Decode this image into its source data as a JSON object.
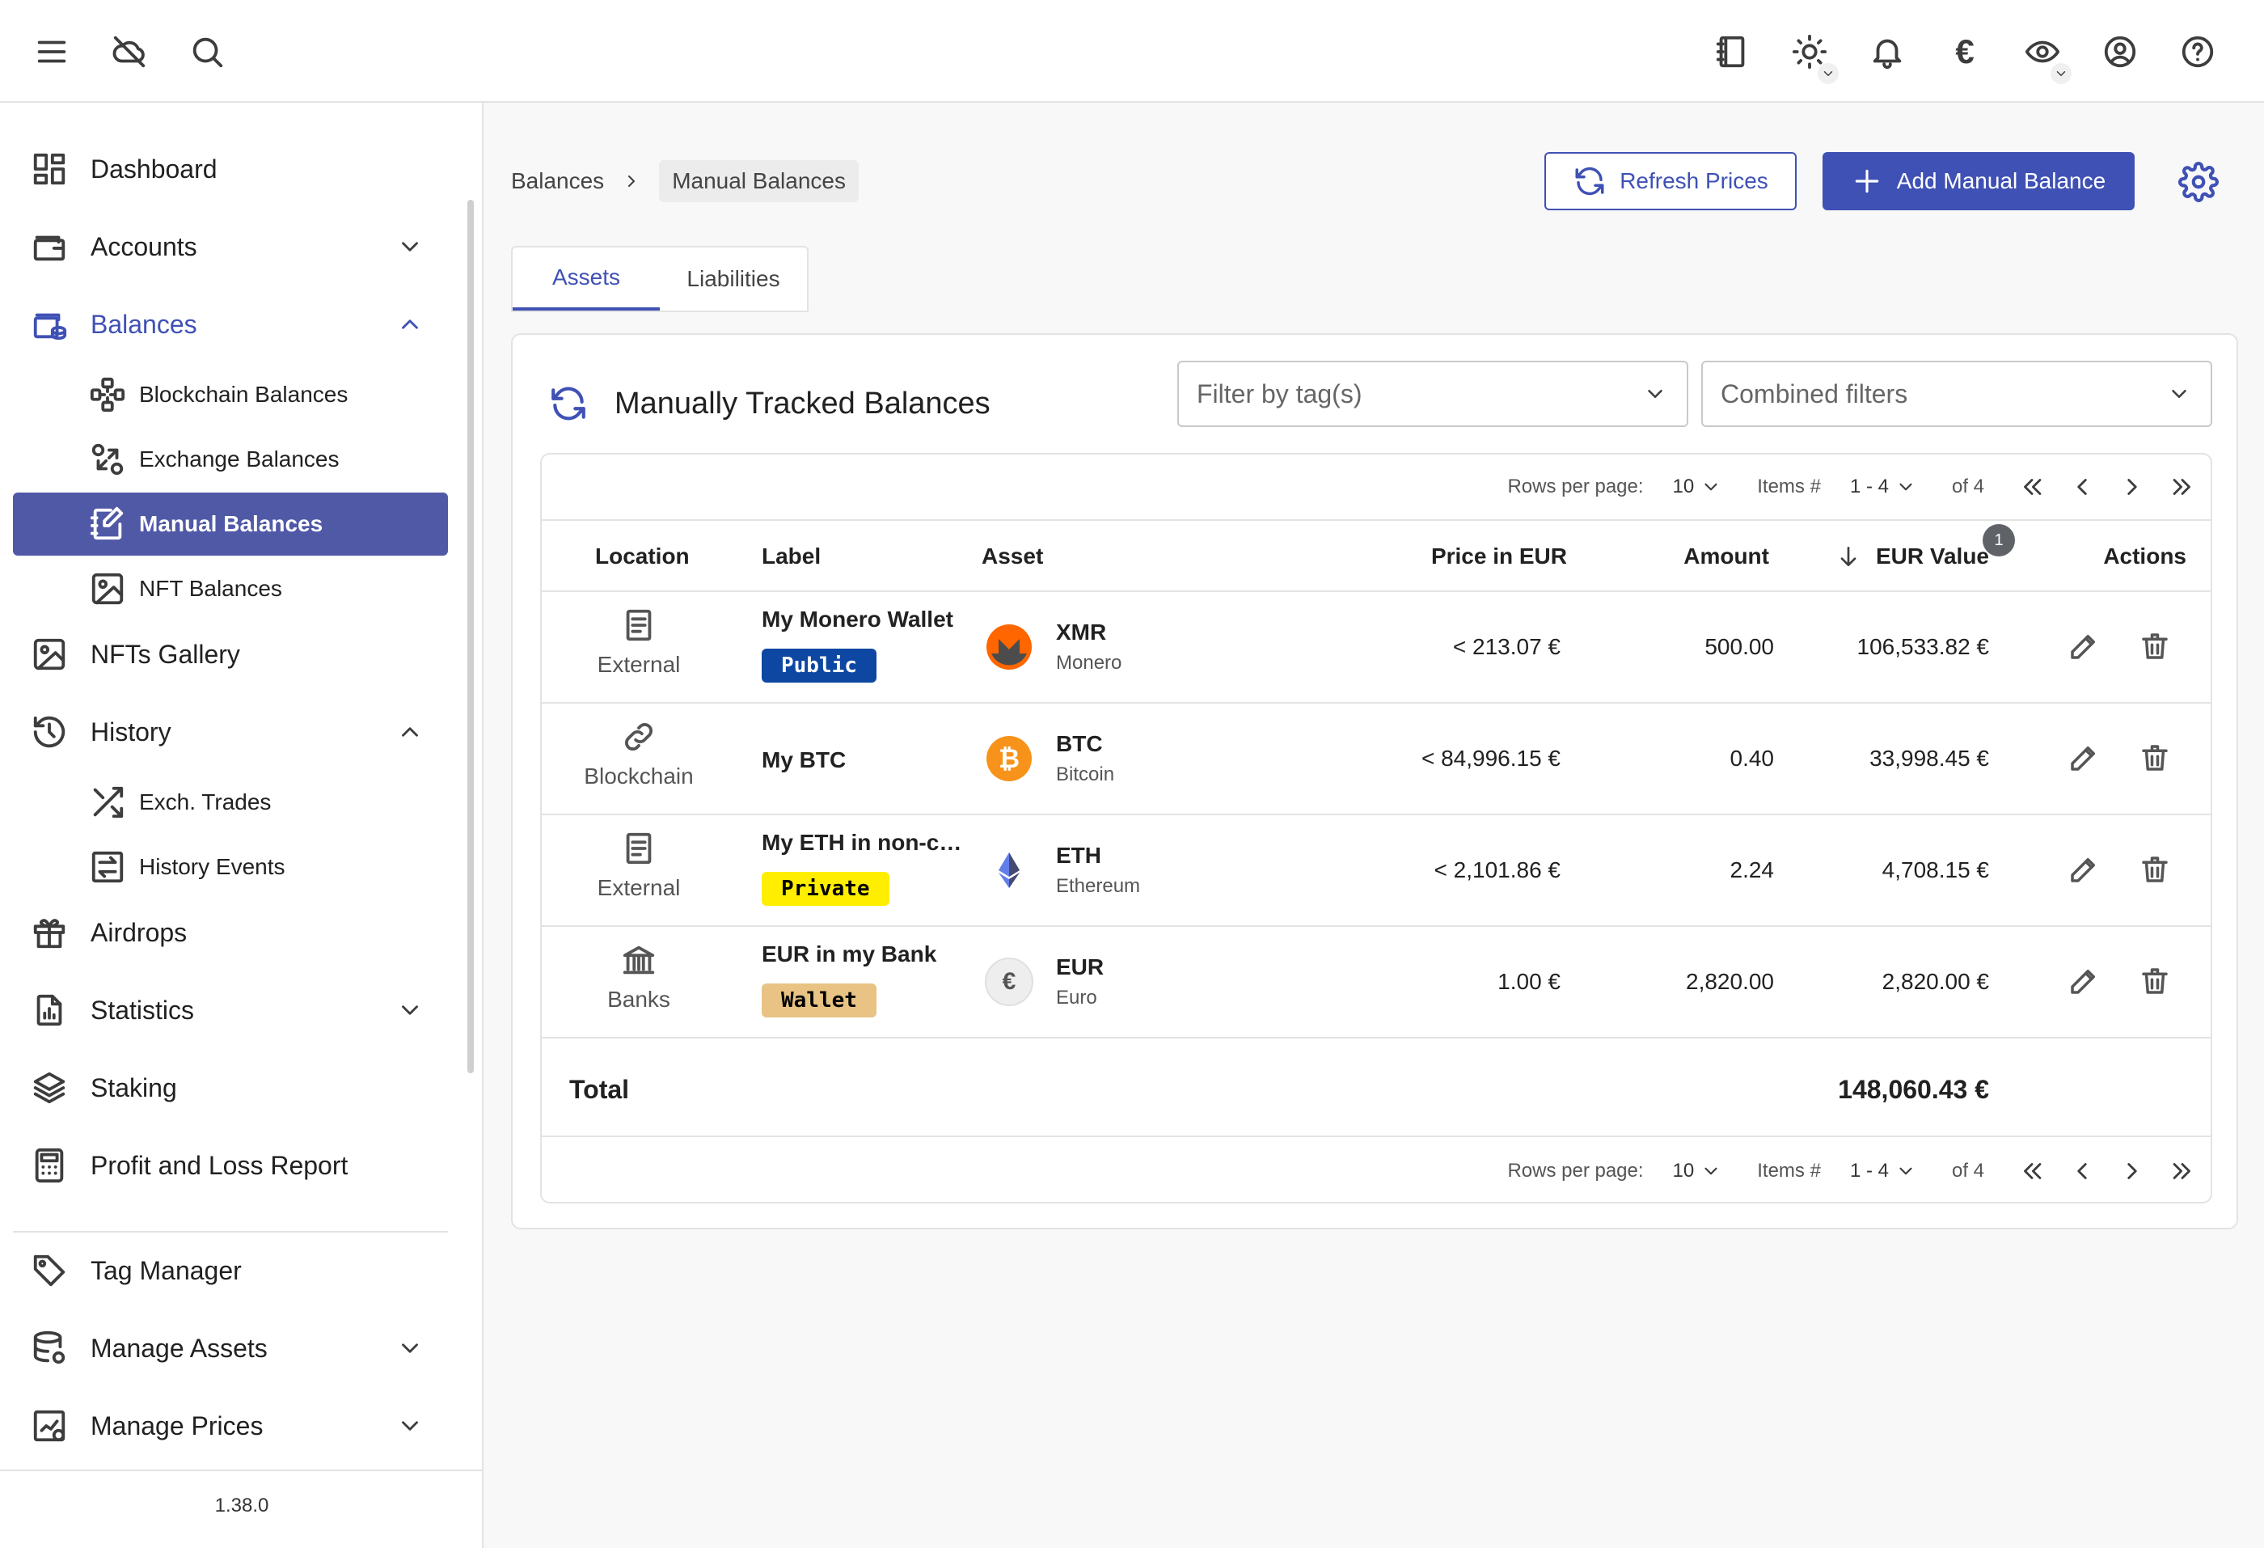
{
  "topbar": {
    "icons": [
      "menu-icon",
      "cloud-off-icon",
      "search-icon",
      "notes-icon",
      "theme-icon",
      "bell-icon",
      "currency-icon",
      "privacy-eye-icon",
      "account-icon",
      "help-icon"
    ],
    "currency_symbol": "€"
  },
  "sidebar": {
    "items": {
      "dashboard": "Dashboard",
      "accounts": "Accounts",
      "balances": "Balances",
      "blockchain_balances": "Blockchain Balances",
      "exchange_balances": "Exchange Balances",
      "manual_balances": "Manual Balances",
      "nft_balances": "NFT Balances",
      "nfts_gallery": "NFTs Gallery",
      "history": "History",
      "exch_trades": "Exch. Trades",
      "history_events": "History Events",
      "airdrops": "Airdrops",
      "statistics": "Statistics",
      "staking": "Staking",
      "pnl_report": "Profit and Loss Report",
      "tag_manager": "Tag Manager",
      "manage_assets": "Manage Assets",
      "manage_prices": "Manage Prices"
    },
    "version": "1.38.0",
    "accent": "#3f51b5"
  },
  "breadcrumb": {
    "parent": "Balances",
    "current": "Manual Balances"
  },
  "header": {
    "refresh_label": "Refresh Prices",
    "add_label": "Add Manual Balance"
  },
  "tabs": {
    "assets": "Assets",
    "liabilities": "Liabilities",
    "active": "Assets"
  },
  "card": {
    "title": "Manually Tracked Balances",
    "filter_placeholder": "Filter by tag(s)",
    "combined_placeholder": "Combined filters"
  },
  "pager": {
    "rows_label": "Rows per page:",
    "rows_value": "10",
    "items_label": "Items #",
    "items_value": "1 - 4",
    "of_label": "of 4"
  },
  "table": {
    "headers": {
      "location": "Location",
      "label": "Label",
      "asset": "Asset",
      "price": "Price in EUR",
      "amount": "Amount",
      "value": "EUR Value",
      "actions": "Actions"
    },
    "sort_badge": "1",
    "rows": [
      {
        "location": "External",
        "label": "My Monero Wallet",
        "tag": "Public",
        "tag_bg": "#0d47a1",
        "tag_fg": "#ffffff",
        "symbol": "XMR",
        "name": "Monero",
        "price": "< 213.07 €",
        "amount": "500.00",
        "value": "106,533.82 €"
      },
      {
        "location": "Blockchain",
        "label": "My BTC",
        "tag": "",
        "symbol": "BTC",
        "name": "Bitcoin",
        "price": "< 84,996.15 €",
        "amount": "0.40",
        "value": "33,998.45 €"
      },
      {
        "location": "External",
        "label": "My ETH in non-custodial wallet",
        "tag": "Private",
        "tag_bg": "#ffee00",
        "tag_fg": "#000000",
        "symbol": "ETH",
        "name": "Ethereum",
        "price": "< 2,101.86 €",
        "amount": "2.24",
        "value": "4,708.15 €"
      },
      {
        "location": "Banks",
        "label": "EUR in my Bank",
        "tag": "Wallet",
        "tag_bg": "#e8c384",
        "tag_fg": "#000000",
        "symbol": "EUR",
        "name": "Euro",
        "price": "1.00 €",
        "amount": "2,820.00",
        "value": "2,820.00 €"
      }
    ],
    "total_label": "Total",
    "total_value": "148,060.43 €"
  }
}
